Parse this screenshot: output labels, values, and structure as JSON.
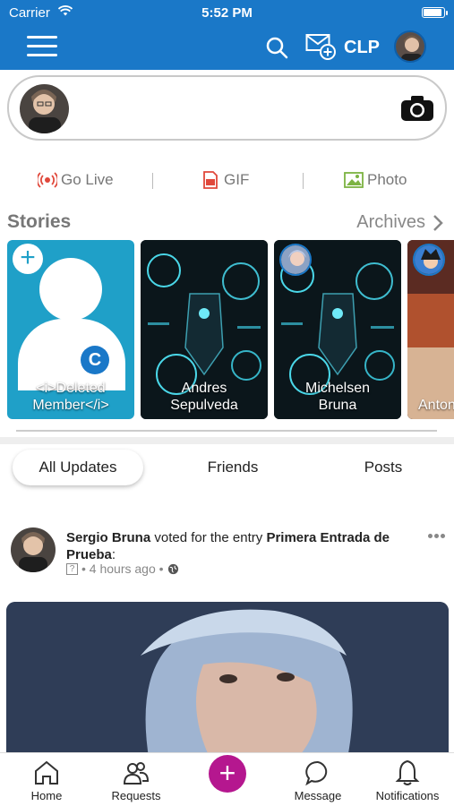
{
  "status_bar": {
    "carrier": "Carrier",
    "time": "5:52 PM"
  },
  "header": {
    "brand": "CLP",
    "icons": [
      "menu-icon",
      "search-icon",
      "compose-message-icon"
    ]
  },
  "composer": {
    "icons": [
      "camera-icon"
    ]
  },
  "actions": {
    "go_live": "Go Live",
    "gif": "GIF",
    "photo": "Photo"
  },
  "stories": {
    "title": "Stories",
    "archives": "Archives",
    "items": [
      {
        "name_line1": "<i>Deleted",
        "name_line2": "Member</i>"
      },
      {
        "name_line1": "Andres",
        "name_line2": "Sepulveda"
      },
      {
        "name_line1": "Michelsen",
        "name_line2": "Bruna"
      },
      {
        "name_line1": "Anton",
        "name_line2": ""
      }
    ],
    "create_badge": "C"
  },
  "tabs": [
    "All Updates",
    "Friends",
    "Posts"
  ],
  "feed": {
    "author": "Sergio Bruna",
    "action": " voted for the entry ",
    "entry": "Primera Entrada de Prueba",
    "colon": ":",
    "time": "• 4 hours ago •",
    "q": "?"
  },
  "bottom_nav": {
    "home": "Home",
    "requests": "Requests",
    "message": "Message",
    "notifications": "Notifications",
    "fab": "+"
  },
  "colors": {
    "header": "#1a78c8",
    "story_create": "#1fa0c8",
    "fab": "#b5178f"
  }
}
